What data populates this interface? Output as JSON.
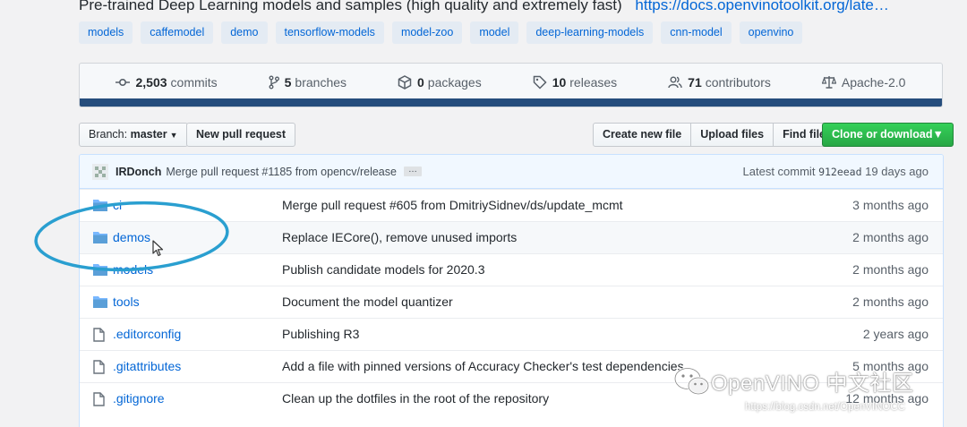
{
  "repo": {
    "description": "Pre-trained Deep Learning models and samples (high quality and extremely fast)",
    "homepage": "https://docs.openvinotoolkit.org/late…"
  },
  "topics": [
    "models",
    "caffemodel",
    "demo",
    "tensorflow-models",
    "model-zoo",
    "model",
    "deep-learning-models",
    "cnn-model",
    "openvino"
  ],
  "stats": {
    "commits": {
      "num": "2,503",
      "label": "commits",
      "icon": "history-icon"
    },
    "branches": {
      "num": "5",
      "label": "branches",
      "icon": "branch-icon"
    },
    "packages": {
      "num": "0",
      "label": "packages",
      "icon": "package-icon"
    },
    "releases": {
      "num": "10",
      "label": "releases",
      "icon": "tag-icon"
    },
    "contributors": {
      "num": "71",
      "label": "contributors",
      "icon": "people-icon"
    },
    "license": {
      "label": "Apache-2.0",
      "icon": "law-icon"
    }
  },
  "toolbar": {
    "branch_label": "Branch:",
    "branch_value": "master",
    "new_pr": "New pull request",
    "create_file": "Create new file",
    "upload_files": "Upload files",
    "find_file": "Find file",
    "clone": "Clone or download"
  },
  "colors": {
    "link": "#0366d6",
    "clone_green": "#28a745",
    "annotation_circle": "#2a9fd0",
    "language_bar": "#254d7c"
  },
  "latest_commit": {
    "author": "IRDonch",
    "message": "Merge pull request #1185 from opencv/release",
    "ellipsis": "…",
    "prefix": "Latest commit",
    "sha": "912eead",
    "age": "19 days ago"
  },
  "files": [
    {
      "type": "dir",
      "name": "ci",
      "message": "Merge pull request #605 from DmitriySidnev/ds/update_mcmt",
      "age": "3 months ago"
    },
    {
      "type": "dir",
      "name": "demos",
      "message": "Replace IECore(), remove unused imports",
      "age": "2 months ago"
    },
    {
      "type": "dir",
      "name": "models",
      "message": "Publish candidate models for 2020.3",
      "age": "2 months ago"
    },
    {
      "type": "dir",
      "name": "tools",
      "message": "Document the model quantizer",
      "age": "2 months ago"
    },
    {
      "type": "file",
      "name": ".editorconfig",
      "message": "Publishing R3",
      "age": "2 years ago"
    },
    {
      "type": "file",
      "name": ".gitattributes",
      "message": "Add a file with pinned versions of Accuracy Checker's test dependencies",
      "age": "5 months ago"
    },
    {
      "type": "file",
      "name": ".gitignore",
      "message": "Clean up the dotfiles in the root of the repository",
      "age": "12 months ago"
    }
  ],
  "watermark": {
    "text": "OpenVINO 中文社区",
    "url": "https://blog.csdn.net/OpenVINOCC"
  }
}
